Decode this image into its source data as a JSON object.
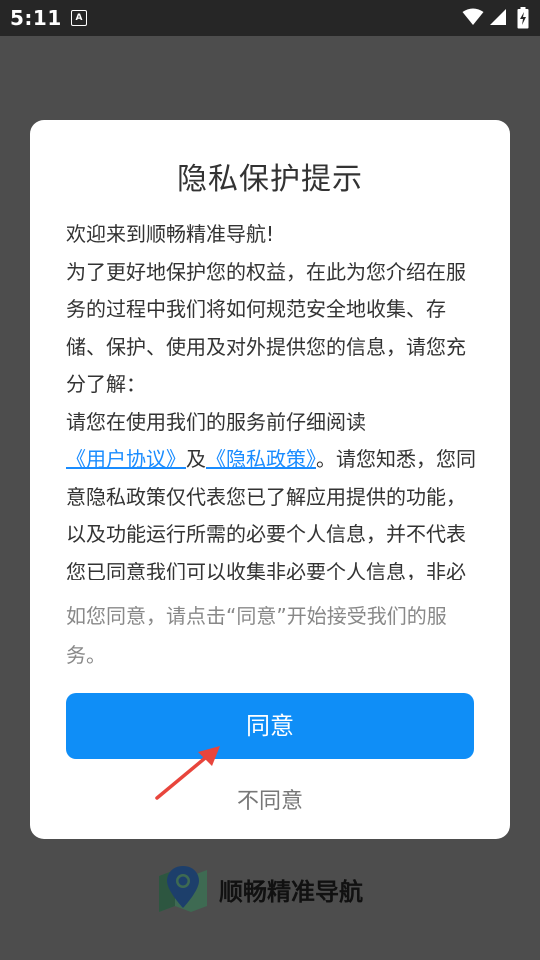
{
  "status_bar": {
    "time": "5:11",
    "notification_icon": "A"
  },
  "dialog": {
    "title": "隐私保护提示",
    "welcome": "欢迎来到顺畅精准导航!",
    "intro": "为了更好地保护您的权益，在此为您介绍在服务的过程中我们将如何规范安全地收集、存储、保护、使用及对外提供您的信息，请您充分了解：",
    "read_prefix": "请您在使用我们的服务前仔细阅读",
    "user_agreement_link": "《用户协议》",
    "and_text": "及",
    "privacy_policy_link": "《隐私政策》",
    "read_suffix": "。请您知悉，您同意隐私政策仅代表您已了解应用提供的功能，以及功能运行所需的必要个人信息，并不代表您已同意我们可以收集非必要个人信息，非必要个人",
    "notice": "如您同意，请点击“同意”开始接受我们的服务。",
    "agree_label": "同意",
    "disagree_label": "不同意"
  },
  "brand": {
    "app_name": "顺畅精准导航"
  },
  "colors": {
    "accent": "#0f8ef7",
    "link": "#1a8cff",
    "backdrop": "#4d4d4d",
    "annotation_arrow": "#e8453c"
  }
}
